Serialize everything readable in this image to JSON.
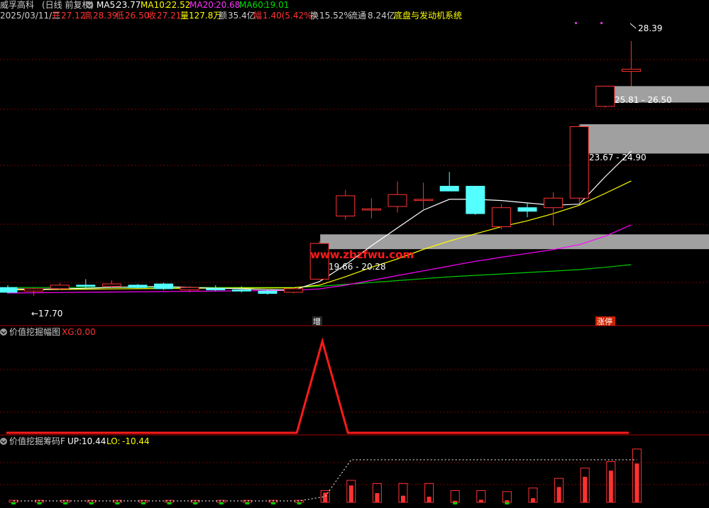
{
  "header": {
    "stock_name": "威孚高科",
    "period": "(日线 前复权)",
    "ma5_label": "MA5:",
    "ma5": "23.77",
    "ma10_label": "MA10:",
    "ma10": "22.52",
    "ma20_label": "MA20:",
    "ma20": "20.68",
    "ma60_label": "MA60:",
    "ma60": "19.01",
    "date": "2025/03/11/二",
    "open_label": "开",
    "open": "27.12",
    "high_label": "高",
    "high": "28.39",
    "low_label": "低",
    "low": "26.50",
    "close_label": "收",
    "close": "27.21",
    "volume_label": "量",
    "volume": "127.8万",
    "amount_label": "额",
    "amount": "35.4亿",
    "change_label": "幅",
    "change": "1.40(5.42%)",
    "turnover_label": "换",
    "turnover": "15.52%",
    "float_label": "流通",
    "float_value": "8.24亿",
    "sector": "底盘与发动机系统"
  },
  "annotations": {
    "high_price": "28.39",
    "low_price": "←17.70",
    "zone_top": "25.81 - 26.50",
    "zone_mid": "23.67 - 24.90",
    "zone_low": "19.66 - 20.28",
    "watermark": "www.zbzfwu.com",
    "tag_increase": "增",
    "tag_limitup": "涨停"
  },
  "panel2": {
    "title": "价值挖掘幅图",
    "xg_label": "XG:",
    "xg_value": "0.00"
  },
  "panel3": {
    "title": "价值挖掘筹码F",
    "up_label": "UP:",
    "up_value": "10.44",
    "lo_label": "LO:",
    "lo_value": "-10.44"
  },
  "colors": {
    "up": "#ff3232",
    "down": "#54ffff",
    "ma5": "#ffffff",
    "ma10": "#ffff00",
    "ma20": "#ff00ff",
    "ma60": "#00cc00",
    "zone": "#a0a0a0"
  },
  "chart_data": {
    "type": "candlestick",
    "y_range": [
      17.0,
      29.0
    ],
    "candles": [
      {
        "o": 18.05,
        "h": 18.15,
        "l": 17.8,
        "c": 17.85
      },
      {
        "o": 17.9,
        "h": 18.05,
        "l": 17.7,
        "c": 18.0
      },
      {
        "o": 18.0,
        "h": 18.25,
        "l": 17.95,
        "c": 18.15
      },
      {
        "o": 18.15,
        "h": 18.4,
        "l": 18.0,
        "c": 18.1
      },
      {
        "o": 18.1,
        "h": 18.35,
        "l": 18.0,
        "c": 18.2
      },
      {
        "o": 18.15,
        "h": 18.2,
        "l": 18.0,
        "c": 18.05
      },
      {
        "o": 18.2,
        "h": 18.25,
        "l": 17.95,
        "c": 18.0
      },
      {
        "o": 17.95,
        "h": 18.1,
        "l": 17.85,
        "c": 18.05
      },
      {
        "o": 18.0,
        "h": 18.15,
        "l": 17.9,
        "c": 17.95
      },
      {
        "o": 17.95,
        "h": 18.1,
        "l": 17.85,
        "c": 17.9
      },
      {
        "o": 17.9,
        "h": 17.95,
        "l": 17.75,
        "c": 17.8
      },
      {
        "o": 17.85,
        "h": 18.05,
        "l": 17.8,
        "c": 18.0
      },
      {
        "o": 18.4,
        "h": 20.0,
        "l": 18.4,
        "c": 19.9
      },
      {
        "o": 21.05,
        "h": 22.15,
        "l": 20.9,
        "c": 21.9
      },
      {
        "o": 21.3,
        "h": 21.8,
        "l": 20.95,
        "c": 21.35
      },
      {
        "o": 21.45,
        "h": 22.5,
        "l": 21.2,
        "c": 21.95
      },
      {
        "o": 21.7,
        "h": 22.45,
        "l": 21.3,
        "c": 21.75
      },
      {
        "o": 22.3,
        "h": 22.9,
        "l": 22.1,
        "c": 22.1
      },
      {
        "o": 22.3,
        "h": 22.3,
        "l": 21.1,
        "c": 21.15
      },
      {
        "o": 20.6,
        "h": 21.55,
        "l": 20.5,
        "c": 21.4
      },
      {
        "o": 21.4,
        "h": 21.6,
        "l": 21.0,
        "c": 21.25
      },
      {
        "o": 21.4,
        "h": 22.05,
        "l": 20.65,
        "c": 21.8
      },
      {
        "o": 21.8,
        "h": 24.9,
        "l": 21.6,
        "c": 24.8
      },
      {
        "o": 25.65,
        "h": 26.5,
        "l": 25.6,
        "c": 26.5
      },
      {
        "o": 27.12,
        "h": 28.39,
        "l": 26.5,
        "c": 27.21
      }
    ],
    "ma5": [
      18.0,
      17.98,
      17.99,
      18.02,
      18.05,
      18.08,
      18.09,
      18.05,
      18.02,
      18.0,
      17.96,
      17.94,
      18.3,
      19.0,
      19.8,
      20.55,
      21.3,
      21.75,
      21.75,
      21.7,
      21.6,
      21.5,
      21.55,
      22.7,
      23.77
    ],
    "ma10": [
      17.95,
      17.96,
      17.97,
      17.98,
      17.99,
      18.0,
      18.01,
      18.02,
      18.02,
      18.03,
      18.03,
      18.04,
      18.15,
      18.5,
      18.9,
      19.25,
      19.65,
      20.0,
      20.3,
      20.6,
      20.85,
      21.15,
      21.5,
      22.0,
      22.52
    ],
    "ma20": [
      17.82,
      17.83,
      17.84,
      17.85,
      17.86,
      17.87,
      17.88,
      17.89,
      17.9,
      17.91,
      17.92,
      17.93,
      17.99,
      18.15,
      18.35,
      18.55,
      18.75,
      18.95,
      19.15,
      19.32,
      19.48,
      19.64,
      19.85,
      20.2,
      20.68
    ],
    "ma60": [
      18.05,
      18.05,
      18.05,
      18.05,
      18.05,
      18.05,
      18.05,
      18.05,
      18.05,
      18.05,
      18.05,
      18.05,
      18.1,
      18.18,
      18.26,
      18.34,
      18.42,
      18.5,
      18.56,
      18.62,
      18.68,
      18.74,
      18.8,
      18.9,
      19.01
    ],
    "zones": [
      {
        "label": "25.81 - 26.50",
        "lo": 25.81,
        "hi": 26.5
      },
      {
        "label": "23.67 - 24.90",
        "lo": 23.67,
        "hi": 24.9
      },
      {
        "label": "19.66 - 20.28",
        "lo": 19.66,
        "hi": 20.28
      }
    ],
    "signal_xg": [
      0,
      0,
      0,
      0,
      0,
      0,
      0,
      0,
      0,
      0,
      0,
      0,
      1,
      0,
      0,
      0,
      0,
      0,
      0,
      0,
      0,
      0,
      0,
      0,
      0
    ],
    "chip_bars": [
      0.4,
      0.4,
      0.4,
      0.4,
      0.4,
      0.4,
      0.4,
      0.4,
      0.4,
      0.4,
      0.4,
      0.4,
      2.3,
      4.3,
      3.7,
      3.7,
      3.7,
      2.3,
      2.3,
      2.1,
      2.8,
      4.7,
      6.7,
      8.0,
      10.44
    ],
    "chip_fill": [
      0,
      0,
      0,
      0,
      0,
      0,
      0,
      0,
      0,
      0,
      0,
      0,
      1.9,
      3.3,
      1.8,
      1.3,
      1.1,
      0.3,
      0.5,
      0.4,
      0.8,
      3.0,
      5.0,
      6.2,
      7.6
    ]
  }
}
